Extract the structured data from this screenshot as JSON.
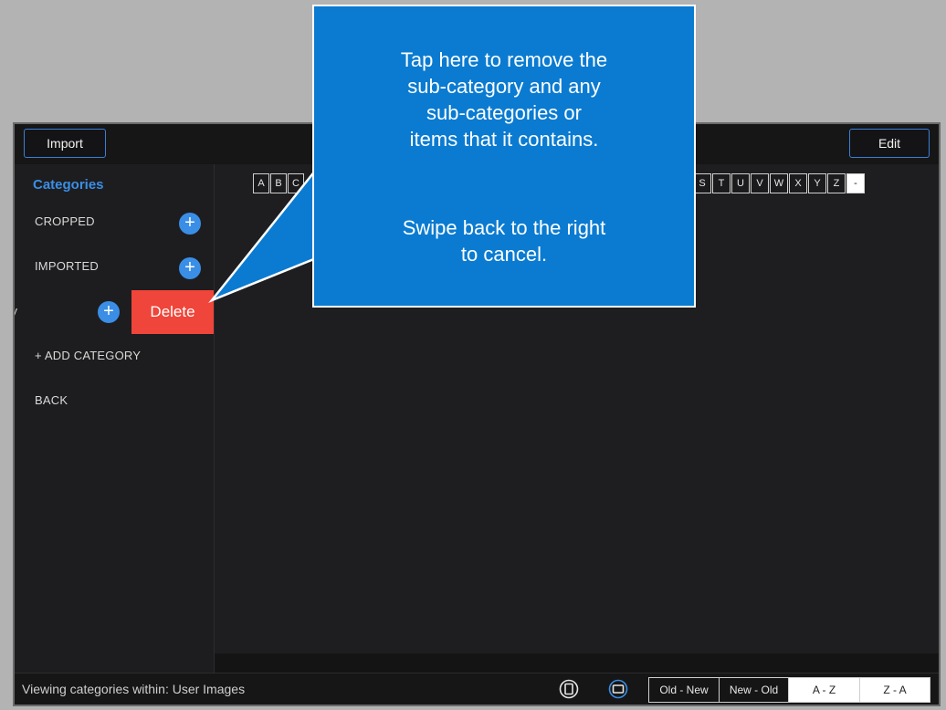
{
  "toolbar": {
    "import_label": "Import",
    "edit_label": "Edit"
  },
  "sidebar": {
    "title": "Categories",
    "items": [
      {
        "label": "CROPPED"
      },
      {
        "label": "IMPORTED"
      },
      {
        "label": "ry"
      }
    ],
    "delete_label": "Delete",
    "add_category": "+ ADD CATEGORY",
    "back": "BACK"
  },
  "alphabet": {
    "left": [
      "A",
      "B",
      "C"
    ],
    "right": [
      "S",
      "T",
      "U",
      "V",
      "W",
      "X",
      "Y",
      "Z",
      "-"
    ]
  },
  "status": {
    "text": "Viewing categories within: User Images"
  },
  "sort": {
    "options": [
      "Old - New",
      "New - Old",
      "A - Z",
      "Z - A"
    ]
  },
  "callout": {
    "line1": "Tap here to remove the",
    "line2": "sub-category and any",
    "line3": "sub-categories or",
    "line4": "items that it contains.",
    "line5": "Swipe back to the right",
    "line6": "to cancel."
  },
  "colors": {
    "accent": "#3a8ee6",
    "delete": "#f0453a",
    "callout": "#0a7bd1"
  }
}
